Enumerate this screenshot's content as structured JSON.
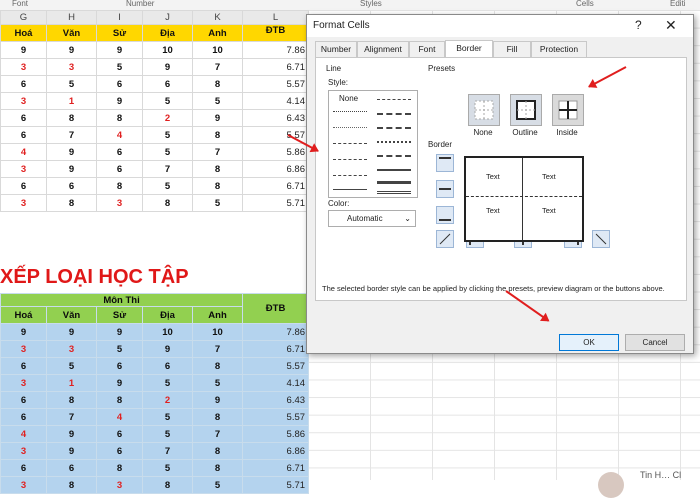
{
  "ribbon": {
    "groups": [
      "Font",
      "Number",
      "Styles",
      "Cells",
      "Editi"
    ]
  },
  "sheet": {
    "columns": [
      "G",
      "H",
      "I",
      "J",
      "K",
      "L"
    ],
    "headers": [
      "Hoá",
      "Văn",
      "Sử",
      "Địa",
      "Anh",
      "ĐTB"
    ],
    "rows": [
      [
        {
          "v": "9",
          "c": "k"
        },
        {
          "v": "9",
          "c": "k"
        },
        {
          "v": "9",
          "c": "k"
        },
        {
          "v": "10",
          "c": "k"
        },
        {
          "v": "10",
          "c": "k"
        },
        "7.86"
      ],
      [
        {
          "v": "3",
          "c": "r"
        },
        {
          "v": "3",
          "c": "r"
        },
        {
          "v": "5",
          "c": "k"
        },
        {
          "v": "9",
          "c": "k"
        },
        {
          "v": "7",
          "c": "k"
        },
        "6.71"
      ],
      [
        {
          "v": "6",
          "c": "k"
        },
        {
          "v": "5",
          "c": "k"
        },
        {
          "v": "6",
          "c": "k"
        },
        {
          "v": "6",
          "c": "k"
        },
        {
          "v": "8",
          "c": "k"
        },
        "5.57"
      ],
      [
        {
          "v": "3",
          "c": "r"
        },
        {
          "v": "1",
          "c": "r"
        },
        {
          "v": "9",
          "c": "k"
        },
        {
          "v": "5",
          "c": "k"
        },
        {
          "v": "5",
          "c": "k"
        },
        "4.14"
      ],
      [
        {
          "v": "6",
          "c": "k"
        },
        {
          "v": "8",
          "c": "k"
        },
        {
          "v": "8",
          "c": "k"
        },
        {
          "v": "2",
          "c": "r"
        },
        {
          "v": "9",
          "c": "k"
        },
        "6.43"
      ],
      [
        {
          "v": "6",
          "c": "k"
        },
        {
          "v": "7",
          "c": "k"
        },
        {
          "v": "4",
          "c": "r"
        },
        {
          "v": "5",
          "c": "k"
        },
        {
          "v": "8",
          "c": "k"
        },
        "5.57"
      ],
      [
        {
          "v": "4",
          "c": "r"
        },
        {
          "v": "9",
          "c": "k"
        },
        {
          "v": "6",
          "c": "k"
        },
        {
          "v": "5",
          "c": "k"
        },
        {
          "v": "7",
          "c": "k"
        },
        "5.86"
      ],
      [
        {
          "v": "3",
          "c": "r"
        },
        {
          "v": "9",
          "c": "k"
        },
        {
          "v": "6",
          "c": "k"
        },
        {
          "v": "7",
          "c": "k"
        },
        {
          "v": "8",
          "c": "k"
        },
        "6.86"
      ],
      [
        {
          "v": "6",
          "c": "k"
        },
        {
          "v": "6",
          "c": "k"
        },
        {
          "v": "8",
          "c": "k"
        },
        {
          "v": "5",
          "c": "k"
        },
        {
          "v": "8",
          "c": "k"
        },
        "6.71"
      ],
      [
        {
          "v": "3",
          "c": "r"
        },
        {
          "v": "8",
          "c": "k"
        },
        {
          "v": "3",
          "c": "r"
        },
        {
          "v": "8",
          "c": "k"
        },
        {
          "v": "5",
          "c": "k"
        },
        "5.71"
      ]
    ]
  },
  "section2": {
    "title": "XẾP LOẠI HỌC TẬP",
    "group_header": "Môn Thi",
    "dtb_header": "ĐTB"
  },
  "dialog": {
    "title": "Format Cells",
    "help": "?",
    "close": "✕",
    "tabs": [
      "Number",
      "Alignment",
      "Font",
      "Border",
      "Fill",
      "Protection"
    ],
    "active_tab": "Border",
    "line_label": "Line",
    "style_label": "Style:",
    "none_label": "None",
    "color_label": "Color:",
    "color_value": "Automatic",
    "presets_label": "Presets",
    "presets": [
      "None",
      "Outline",
      "Inside"
    ],
    "border_label": "Border",
    "preview_text": [
      "Text",
      "Text",
      "Text",
      "Text"
    ],
    "description": "The selected border style can be applied by clicking the presets, preview diagram or the buttons above.",
    "ok": "OK",
    "cancel": "Cancel"
  },
  "bottom": {
    "text": "Tin H… Cl"
  },
  "colors": {
    "yellow_header": "#ffd700",
    "green_header": "#92d050",
    "blue_fill": "#b4d3ee",
    "red_value": "#e02020",
    "title_red": "#e01818",
    "accent": "#0078d7"
  }
}
